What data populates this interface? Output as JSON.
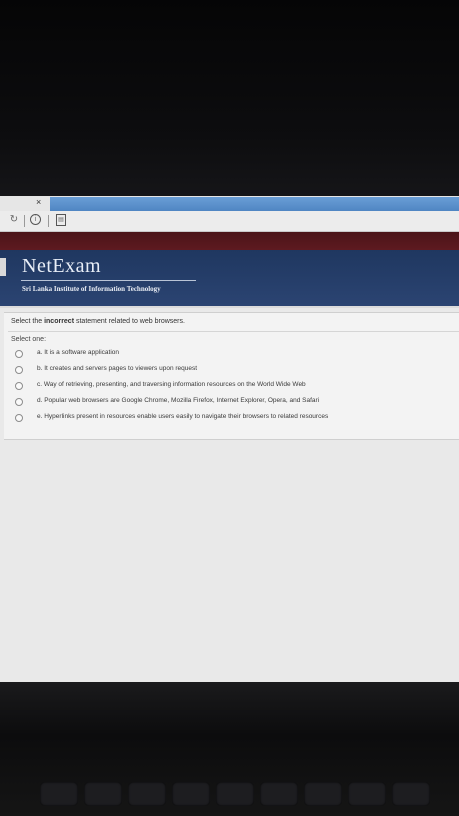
{
  "browser": {
    "tab_close": "×",
    "toolbar_icons": [
      "reload-icon",
      "info-icon",
      "page-icon"
    ]
  },
  "header": {
    "brand": "NetExam",
    "subtitle": "Sri Lanka Institute of Information Technology"
  },
  "question": {
    "prefix": "Select the ",
    "emphasis": "incorrect",
    "suffix": " statement related to web browsers.",
    "select_one": "Select one:",
    "options": [
      {
        "label": "a. It is a software application"
      },
      {
        "label": "b. It creates and servers pages to viewers upon request"
      },
      {
        "label": "c. Way of retrieving, presenting, and traversing information resources on the World Wide Web"
      },
      {
        "label": "d. Popular web browsers are Google Chrome, Mozilla Firefox, Internet Explorer, Opera, and Safari"
      },
      {
        "label": "e. Hyperlinks present in resources enable users easily to navigate their browsers to related resources"
      }
    ]
  },
  "colors": {
    "header_bg": "#233c66",
    "maroon_band": "#561820",
    "accent_blue": "#4b82c0"
  }
}
